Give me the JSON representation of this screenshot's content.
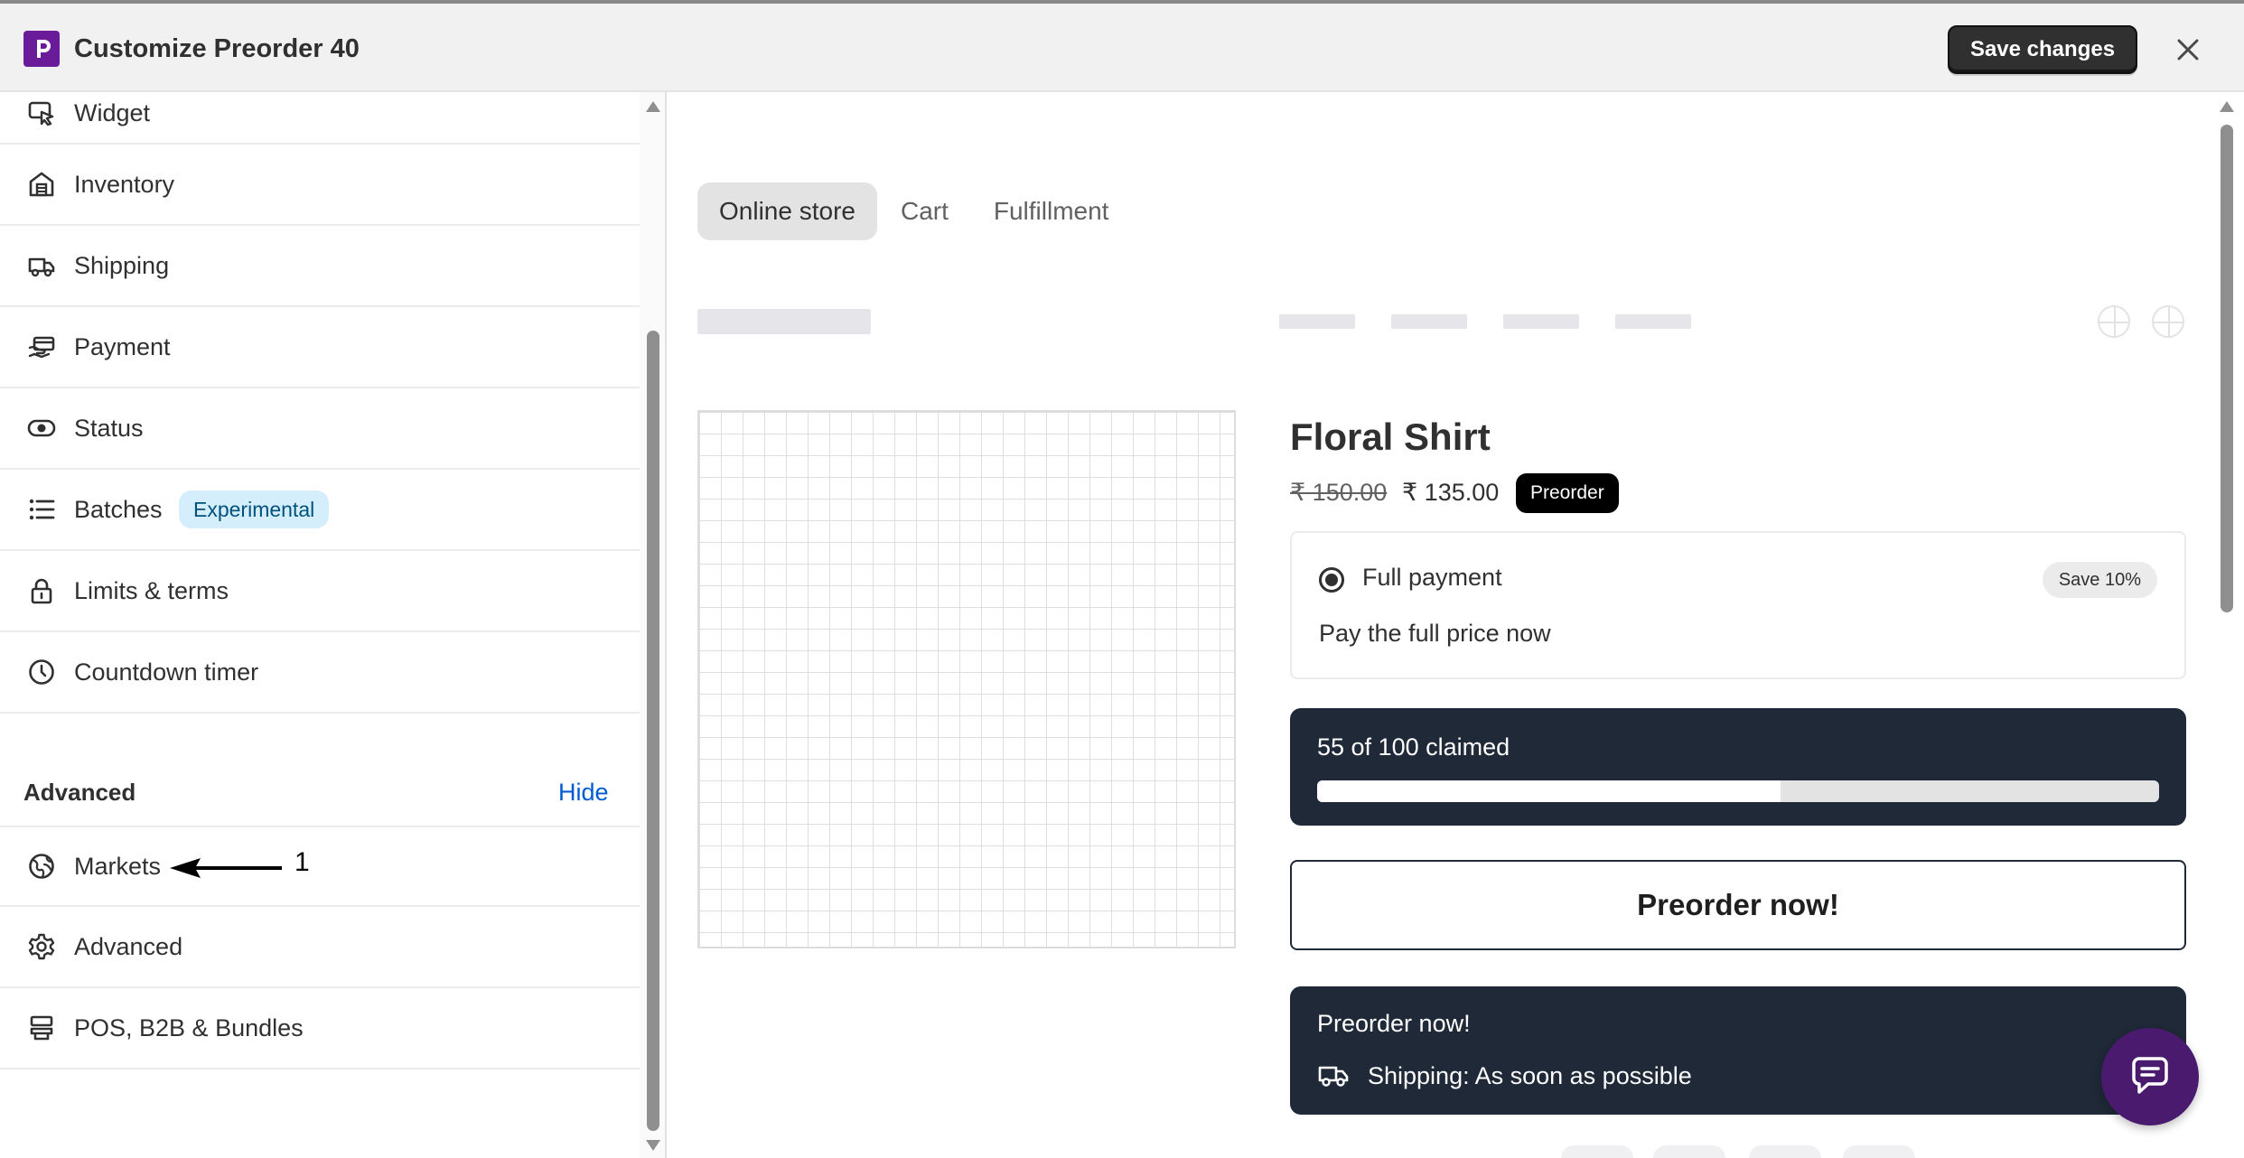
{
  "header": {
    "title": "Customize Preorder 40",
    "save_label": "Save changes"
  },
  "sidebar": {
    "items": [
      {
        "label": "Widget",
        "icon": "cursor-icon"
      },
      {
        "label": "Inventory",
        "icon": "warehouse-icon"
      },
      {
        "label": "Shipping",
        "icon": "truck-icon"
      },
      {
        "label": "Payment",
        "icon": "payment-icon"
      },
      {
        "label": "Status",
        "icon": "toggle-icon"
      },
      {
        "label": "Batches",
        "icon": "list-icon",
        "badge": "Experimental"
      },
      {
        "label": "Limits & terms",
        "icon": "lock-icon"
      },
      {
        "label": "Countdown timer",
        "icon": "clock-icon"
      }
    ],
    "advanced_section": {
      "title": "Advanced",
      "toggle_label": "Hide",
      "items": [
        {
          "label": "Markets",
          "icon": "globe-icon"
        },
        {
          "label": "Advanced",
          "icon": "gear-icon"
        },
        {
          "label": "POS, B2B & Bundles",
          "icon": "store-icon"
        }
      ]
    },
    "annotation": {
      "label": "1"
    }
  },
  "preview": {
    "tabs": [
      {
        "label": "Online store",
        "active": true
      },
      {
        "label": "Cart",
        "active": false
      },
      {
        "label": "Fulfillment",
        "active": false
      }
    ],
    "product": {
      "title": "Floral Shirt",
      "original_price": "₹ 150.00",
      "sale_price": "₹ 135.00",
      "badge": "Preorder"
    },
    "payment_option": {
      "label": "Full payment",
      "tag": "Save 10%",
      "description": "Pay the full price now",
      "selected": true
    },
    "claimed": {
      "text": "55 of 100 claimed",
      "claimed": 55,
      "total": 100
    },
    "preorder_button": "Preorder now!",
    "shipping_box": {
      "title": "Preorder now!",
      "text": "Shipping: As soon as possible"
    }
  },
  "colors": {
    "brand": "#6a1b9a",
    "dark_panel": "#1f2937",
    "link": "#005bd3",
    "badge_experimental_bg": "#d4eefc"
  }
}
